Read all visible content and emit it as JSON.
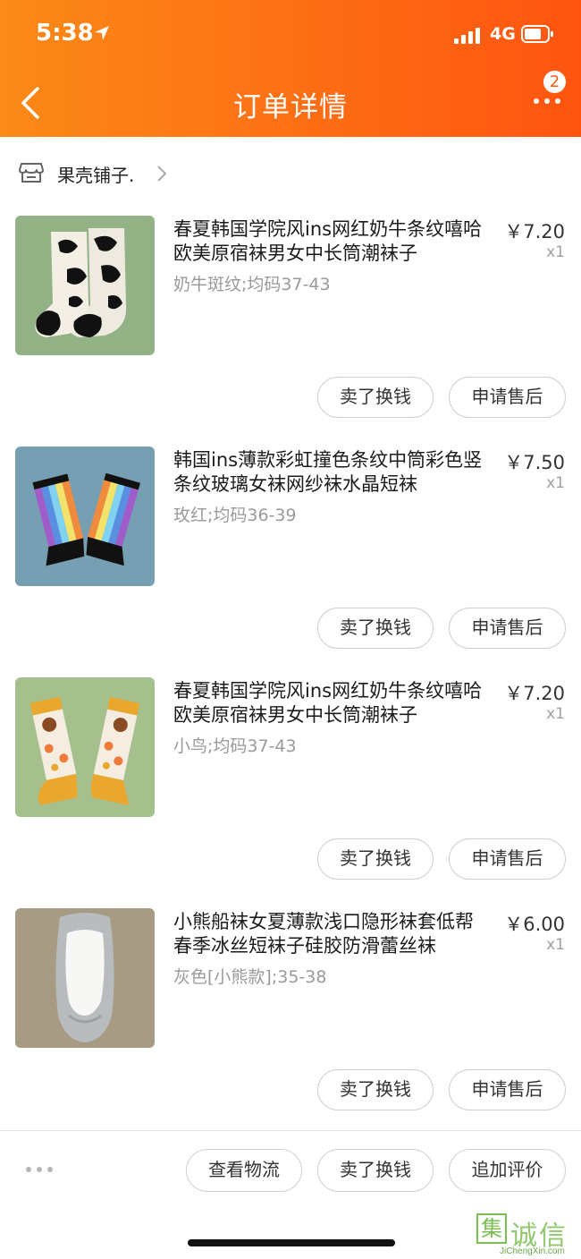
{
  "status_bar": {
    "time": "5:38",
    "network": "4G"
  },
  "header": {
    "title": "订单详情",
    "badge_count": "2"
  },
  "shop": {
    "name": "果壳铺子."
  },
  "items": [
    {
      "title": "春夏韩国学院风ins网红奶牛条纹嘻哈欧美原宿袜男女中长筒潮袜子",
      "spec": "奶牛斑纹;均码37-43",
      "price": "￥7.20",
      "qty": "x1",
      "sell_label": "卖了换钱",
      "service_label": "申请售后"
    },
    {
      "title": "韩国ins薄款彩虹撞色条纹中筒彩色竖条纹玻璃女袜网纱袜水晶短袜",
      "spec": "玫红;均码36-39",
      "price": "￥7.50",
      "qty": "x1",
      "sell_label": "卖了换钱",
      "service_label": "申请售后"
    },
    {
      "title": "春夏韩国学院风ins网红奶牛条纹嘻哈欧美原宿袜男女中长筒潮袜子",
      "spec": "小鸟;均码37-43",
      "price": "￥7.20",
      "qty": "x1",
      "sell_label": "卖了换钱",
      "service_label": "申请售后"
    },
    {
      "title": "小熊船袜女夏薄款浅口隐形袜套低帮春季冰丝短袜子硅胶防滑蕾丝袜",
      "spec": "灰色[小熊款];35-38",
      "price": "￥6.00",
      "qty": "x1",
      "sell_label": "卖了换钱",
      "service_label": "申请售后"
    }
  ],
  "bottom_bar": {
    "logistics_label": "查看物流",
    "sell_label": "卖了换钱",
    "review_label": "追加评价"
  },
  "watermark": {
    "mark": "集",
    "text": "诚信",
    "sub": "JiChengXin.com"
  },
  "colors": {
    "header_start": "#fb8a18",
    "header_end": "#fe5410",
    "watermark": "#7cbf54"
  }
}
